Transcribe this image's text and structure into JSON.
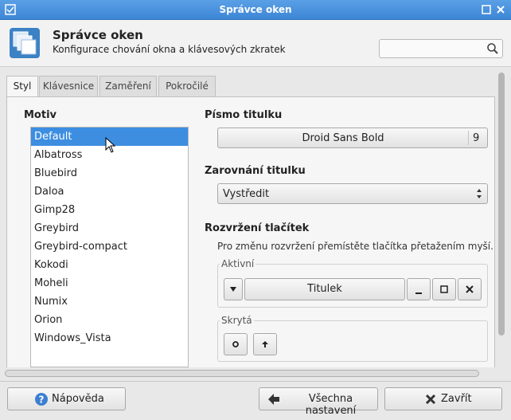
{
  "window": {
    "title": "Správce oken"
  },
  "header": {
    "title": "Správce oken",
    "subtitle": "Konfigurace chování okna a klávesových zkratek",
    "search_placeholder": ""
  },
  "tabs": [
    {
      "label": "Styl",
      "active": true
    },
    {
      "label": "Klávesnice",
      "active": false
    },
    {
      "label": "Zaměření",
      "active": false
    },
    {
      "label": "Pokročilé",
      "active": false
    }
  ],
  "theme": {
    "label": "Motiv",
    "selected": "Default",
    "items": [
      "Default",
      "Albatross",
      "Bluebird",
      "Daloa",
      "Gimp28",
      "Greybird",
      "Greybird-compact",
      "Kokodi",
      "Moheli",
      "Numix",
      "Orion",
      "Windows_Vista"
    ]
  },
  "title_font": {
    "label": "Písmo titulku",
    "font_name": "Droid Sans Bold",
    "font_size": "9"
  },
  "title_alignment": {
    "label": "Zarovnání titulku",
    "value": "Vystředit"
  },
  "button_layout": {
    "label": "Rozvržení tlačítek",
    "hint": "Pro změnu rozvržení přemístěte tlačítka přetažením myší.",
    "active_group": {
      "label": "Aktivní",
      "title_button": "Titulek"
    },
    "hidden_group": {
      "label": "Skrytá"
    }
  },
  "footer": {
    "help": "Nápověda",
    "all_settings": "Všechna nastavení",
    "close": "Zavřít"
  },
  "colors": {
    "titlebar": "#4a93e0",
    "selection": "#3d8ee0"
  }
}
